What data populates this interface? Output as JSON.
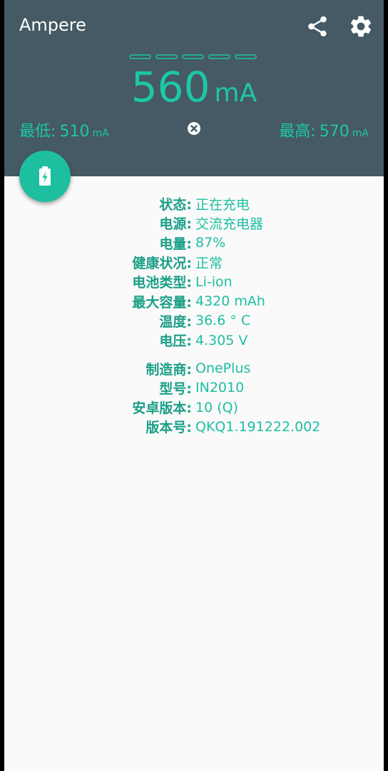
{
  "app": {
    "title": "Ampere"
  },
  "toolbar": {
    "share_icon": "share-icon",
    "settings_icon": "gear-icon"
  },
  "meter": {
    "current_value": "560",
    "current_unit": "mA",
    "min_label": "最低:",
    "min_value": "510",
    "min_unit": "mA",
    "max_label": "最高:",
    "max_value": "570",
    "max_unit": "mA",
    "bars_count": 5
  },
  "fab": {
    "icon": "battery-charging-icon"
  },
  "battery_info": [
    {
      "label": "状态:",
      "value": "正在充电"
    },
    {
      "label": "电源:",
      "value": "交流充电器"
    },
    {
      "label": "电量:",
      "value": "87%"
    },
    {
      "label": "健康状况:",
      "value": "正常"
    },
    {
      "label": "电池类型:",
      "value": "Li-ion"
    },
    {
      "label": "最大容量:",
      "value": "4320 mAh"
    },
    {
      "label": "温度:",
      "value": "36.6 ° C"
    },
    {
      "label": "电压:",
      "value": "4.305 V"
    }
  ],
  "device_info": [
    {
      "label": "制造商:",
      "value": "OnePlus"
    },
    {
      "label": "型号:",
      "value": "IN2010"
    },
    {
      "label": "安卓版本:",
      "value": "10 (Q)"
    },
    {
      "label": "版本号:",
      "value": "QKQ1.191222.002"
    }
  ],
  "colors": {
    "header_bg": "#455a64",
    "accent": "#1dc7a7",
    "label": "#1b9f87",
    "background": "#fafafa"
  }
}
